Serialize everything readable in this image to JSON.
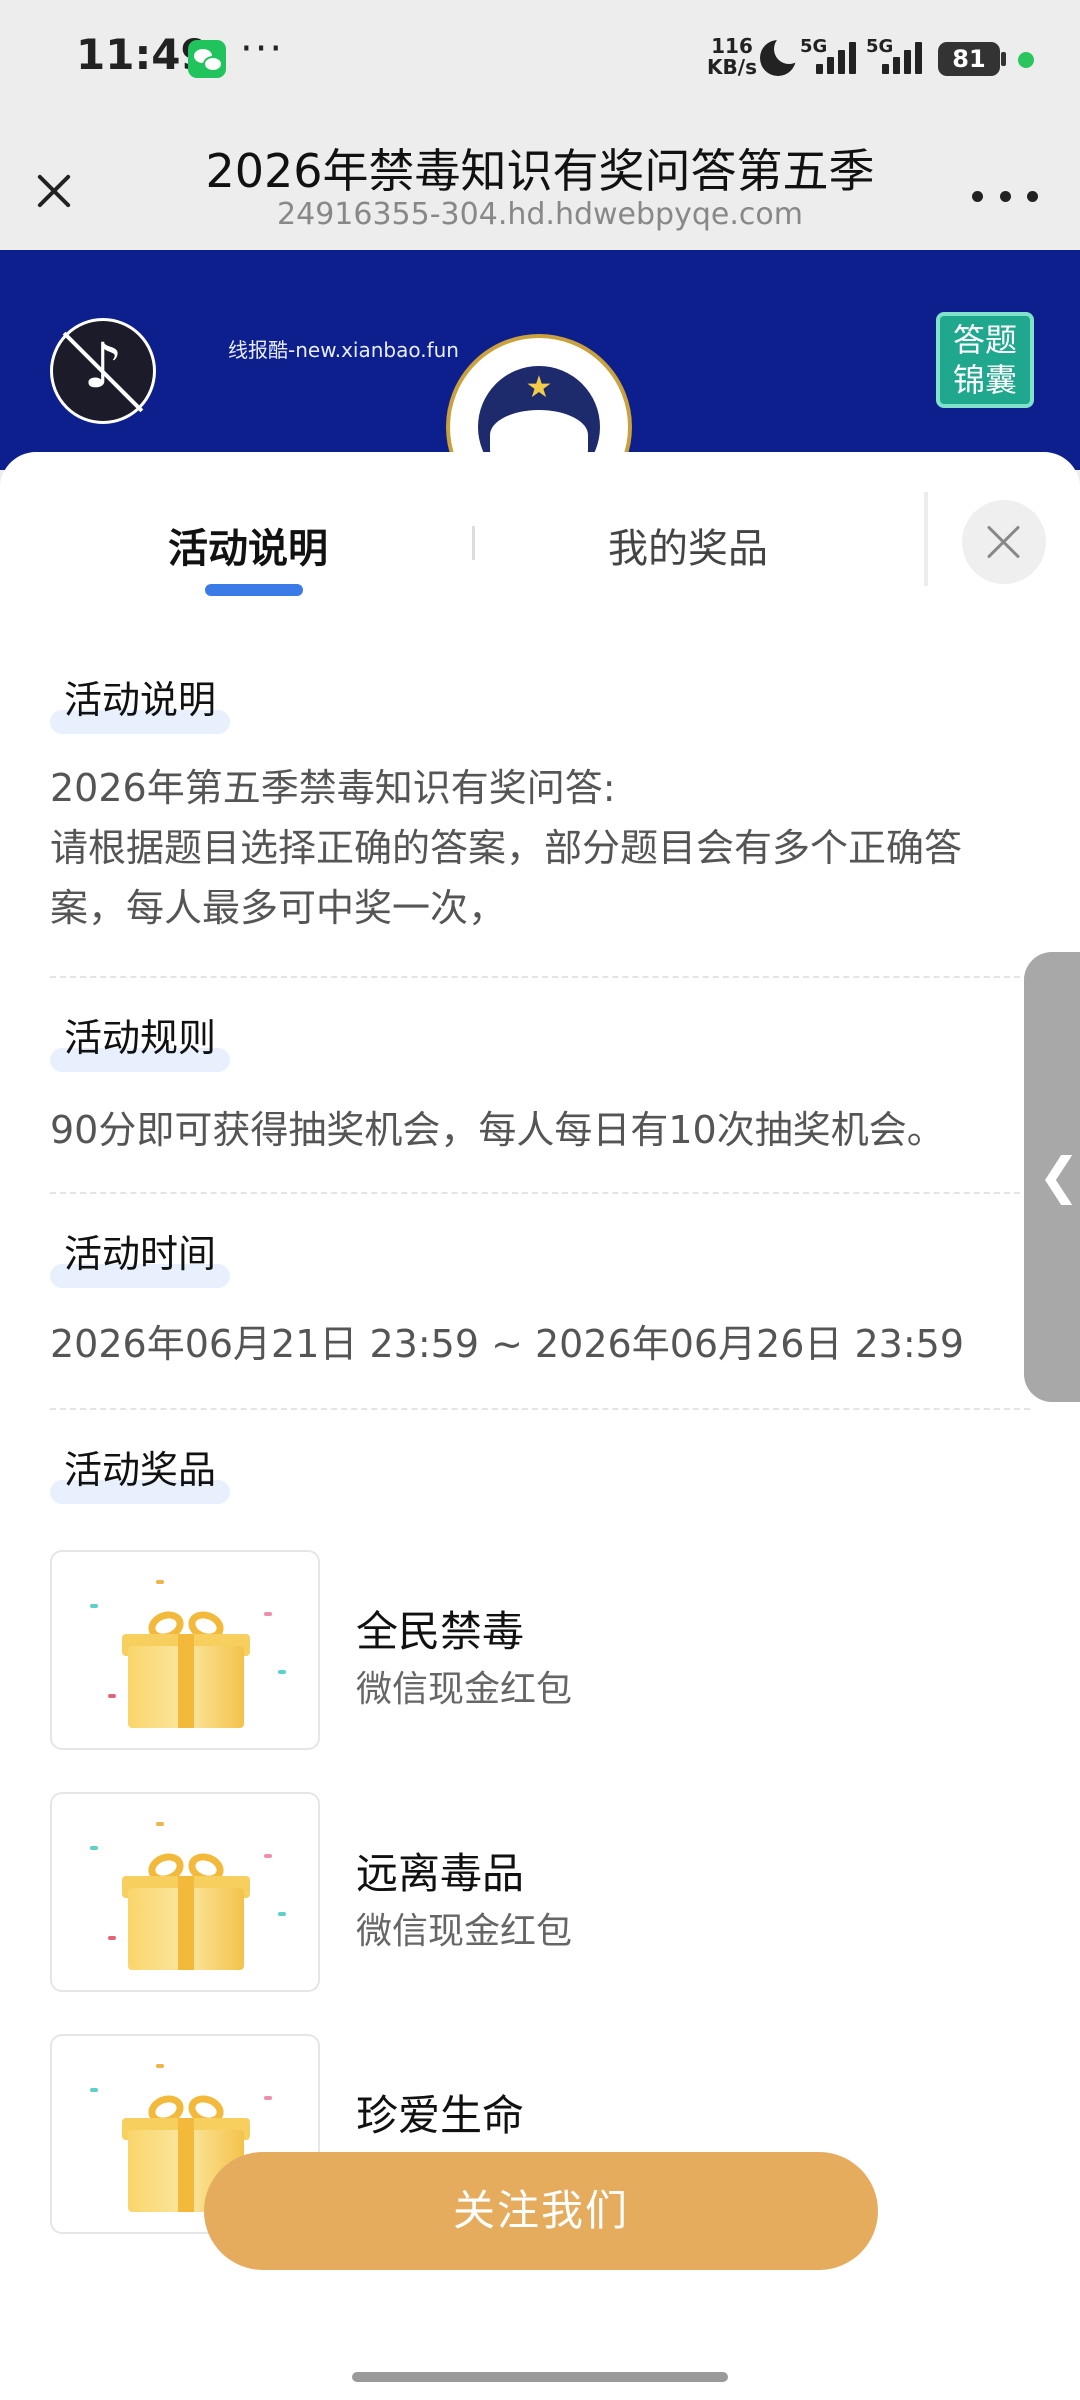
{
  "status_bar": {
    "time": "11:49",
    "network_speed": "116",
    "network_speed_unit": "KB/s",
    "signal_1_label": "5G",
    "signal_2_label": "5G",
    "battery": "81",
    "icons": [
      "wechat-icon",
      "more-dots-icon",
      "moon-icon",
      "signal-icon",
      "battery-icon"
    ]
  },
  "title_bar": {
    "title": "2026年禁毒知识有奖问答第五季",
    "url": "24916355-304.hd.hdwebpyqe.com"
  },
  "banner": {
    "watermark": "线报酷-new.xianbao.fun",
    "answer_tips_line1": "答题",
    "answer_tips_line2": "锦囊",
    "background_color": "#0d1f8c"
  },
  "tabs": [
    {
      "label": "活动说明",
      "active": true
    },
    {
      "label": "我的奖品",
      "active": false
    }
  ],
  "sections": {
    "description": {
      "heading": "活动说明",
      "line1": "2026年第五季禁毒知识有奖问答:",
      "line2": "请根据题目选择正确的答案，部分题目会有多个正确答",
      "line3": "案，每人最多可中奖一次，"
    },
    "rules": {
      "heading": "活动规则",
      "text": "90分即可获得抽奖机会，每人每日有10次抽奖机会。"
    },
    "time": {
      "heading": "活动时间",
      "text": "2026年06月21日 23:59 ~ 2026年06月26日 23:59"
    },
    "prizes": {
      "heading": "活动奖品",
      "items": [
        {
          "name": "全民禁毒",
          "desc": "微信现金红包"
        },
        {
          "name": "远离毒品",
          "desc": "微信现金红包"
        },
        {
          "name": "珍爱生命",
          "desc": ""
        }
      ]
    }
  },
  "side_handle_glyph": "❮",
  "follow_button": "关注我们",
  "colors": {
    "accent_blue": "#3b7be8",
    "button_gold": "#e5ac5e",
    "banner_blue": "#0d1f8c"
  }
}
